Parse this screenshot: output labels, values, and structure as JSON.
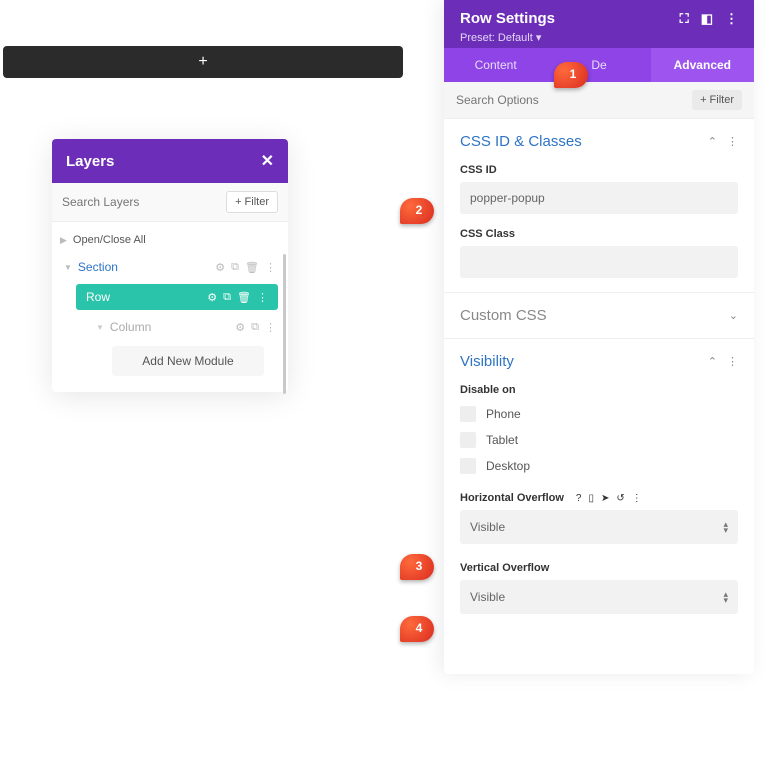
{
  "addbar": {
    "plus": "+"
  },
  "layers": {
    "title": "Layers",
    "search_placeholder": "Search Layers",
    "filter_btn": "+  Filter",
    "open_close": "Open/Close All",
    "section": "Section",
    "row": "Row",
    "column": "Column",
    "add_module": "Add New Module"
  },
  "settings": {
    "title": "Row Settings",
    "preset": "Preset: Default ▾",
    "tabs": {
      "content": "Content",
      "design": "De",
      "advanced": "Advanced"
    },
    "search_placeholder": "Search Options",
    "filter_btn": "+  Filter",
    "acc_css": "CSS ID & Classes",
    "css_id_label": "CSS ID",
    "css_id_value": "popper-popup",
    "css_class_label": "CSS Class",
    "acc_custom": "Custom CSS",
    "acc_vis": "Visibility",
    "disable_on": "Disable on",
    "devices": {
      "phone": "Phone",
      "tablet": "Tablet",
      "desktop": "Desktop"
    },
    "h_overflow": "Horizontal Overflow",
    "v_overflow": "Vertical Overflow",
    "overflow_visible": "Visible"
  },
  "callouts": {
    "c1": "1",
    "c2": "2",
    "c3": "3",
    "c4": "4"
  }
}
